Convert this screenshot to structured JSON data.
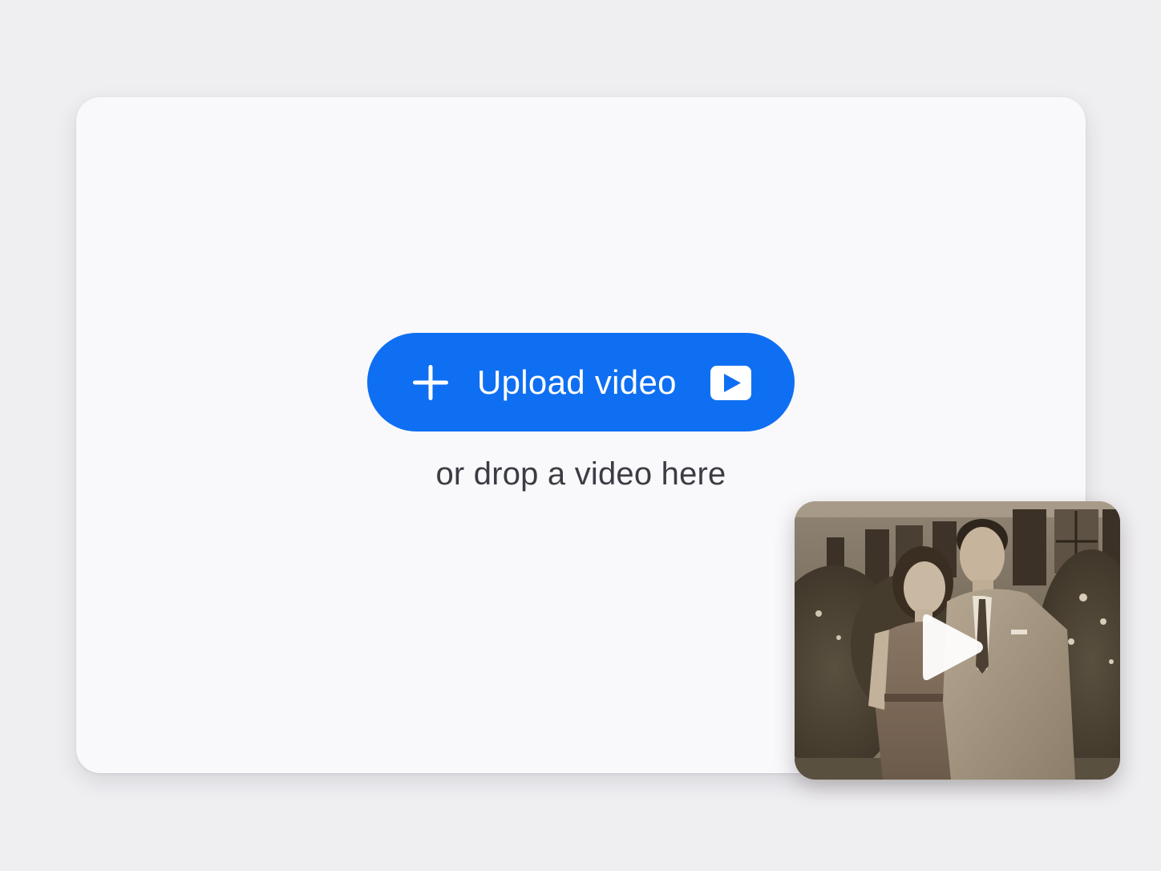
{
  "upload": {
    "button_label": "Upload video",
    "drop_hint": "or drop a video here",
    "icons": {
      "leading": "plus-icon",
      "trailing": "video-play-badge-icon"
    }
  },
  "preview": {
    "overlay_icon": "play-icon",
    "image_description_hidden": true
  },
  "colors": {
    "accent": "#0f6ff2",
    "page_background": "#efeef1",
    "card_background": "#f9f8fb",
    "hint_text": "#3c3c44"
  }
}
